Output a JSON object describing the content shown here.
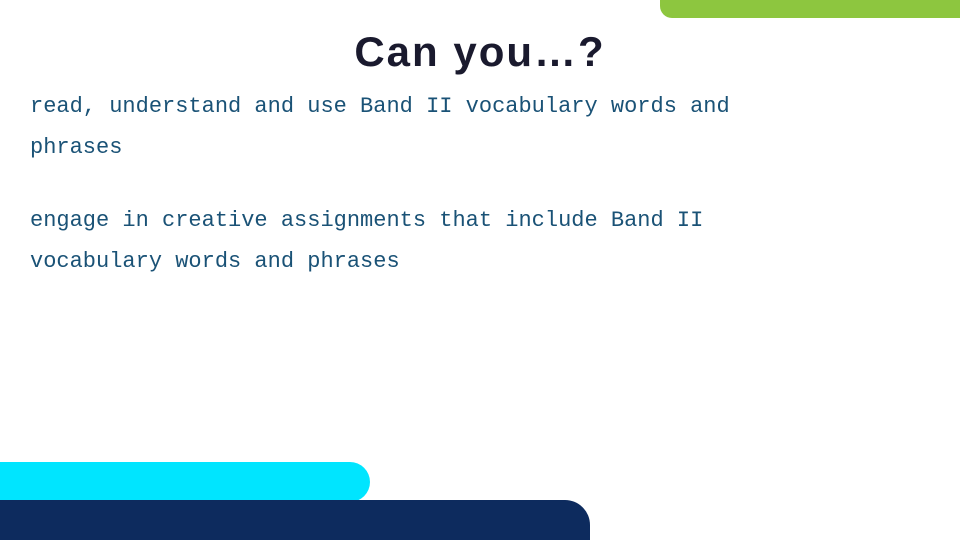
{
  "page": {
    "title": "Can  you…?",
    "line1": "read, understand and use Band II vocabulary words and",
    "line2": "phrases",
    "line3": "engage in creative assignments that include Band II",
    "line4": "vocabulary words and phrases"
  },
  "decorations": {
    "top_bar_color": "#8dc63f",
    "bottom_cyan_color": "#00e5ff",
    "bottom_dark_color": "#0d2b5e",
    "text_color": "#1a5276"
  }
}
